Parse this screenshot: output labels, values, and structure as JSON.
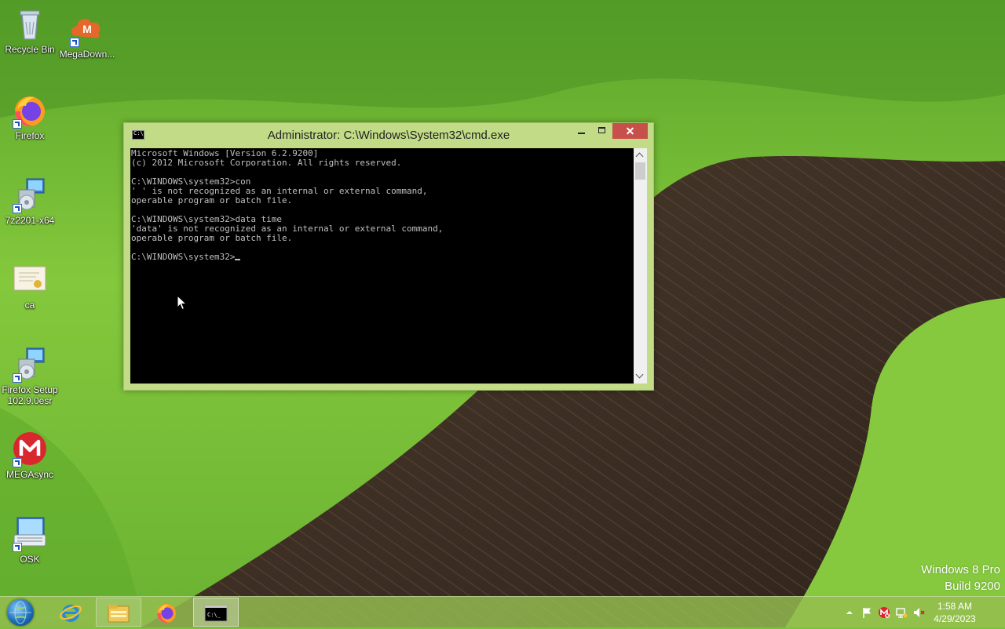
{
  "desktop": {
    "icons": [
      {
        "label": "Recycle Bin",
        "icon": "recycle-bin-icon"
      },
      {
        "label": "MegaDown...",
        "icon": "megadownloader-icon"
      },
      {
        "label": "Firefox",
        "icon": "firefox-icon"
      },
      {
        "label": "7z2201-x64",
        "icon": "installer-icon"
      },
      {
        "label": "ca",
        "icon": "certificate-icon"
      },
      {
        "label": "Firefox Setup 102.9.0esr",
        "icon": "installer-icon"
      },
      {
        "label": "MEGAsync",
        "icon": "mega-icon"
      },
      {
        "label": "OSK",
        "icon": "keyboard-icon"
      }
    ],
    "watermark": {
      "line1": "Windows 8 Pro",
      "line2": "Build 9200"
    }
  },
  "cmd_window": {
    "title": "Administrator: C:\\Windows\\System32\\cmd.exe",
    "icon_text": "C:\\",
    "console_lines": [
      "Microsoft Windows [Version 6.2.9200]",
      "(c) 2012 Microsoft Corporation. All rights reserved.",
      "",
      "C:\\WINDOWS\\system32>con",
      "' ' is not recognized as an internal or external command,",
      "operable program or batch file.",
      "",
      "C:\\WINDOWS\\system32>data time",
      "'data' is not recognized as an internal or external command,",
      "operable program or batch file.",
      "",
      "C:\\WINDOWS\\system32>"
    ]
  },
  "taskbar": {
    "apps": [
      {
        "name": "Internet Explorer",
        "icon": "internet-explorer-icon"
      },
      {
        "name": "File Explorer",
        "icon": "file-explorer-icon"
      },
      {
        "name": "Firefox",
        "icon": "firefox-icon"
      },
      {
        "name": "Command Prompt",
        "icon": "cmd-icon"
      }
    ],
    "terminal_icon_text": "C:\\_",
    "clock": {
      "time": "1:58 AM",
      "date": "4/29/2023"
    }
  },
  "colors": {
    "console_bg": "#000000",
    "console_fg": "#c0c0c0",
    "window_frame": "#c1db86",
    "close_button": "#c7504b"
  }
}
